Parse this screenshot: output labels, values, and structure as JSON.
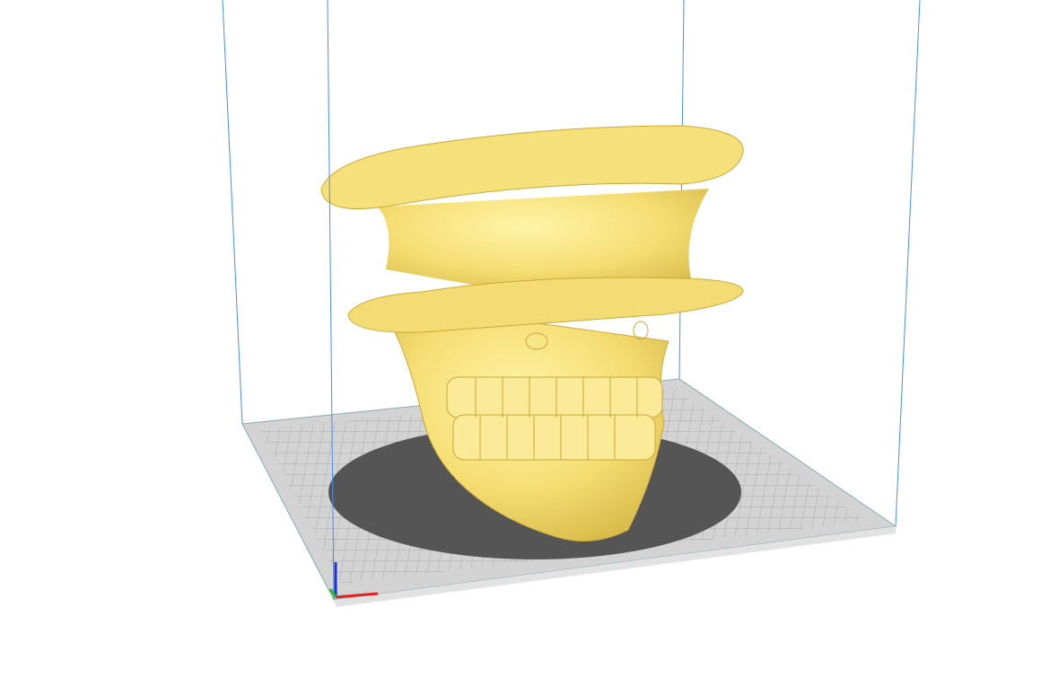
{
  "viewport": {
    "view": "3d-build-volume",
    "colors": {
      "background": "#ffffff",
      "build_volume_lines": "#3b82f6",
      "plate": "#d4d4d4",
      "plate_grid": "#a9a9a9",
      "shadow": "#5a5a5a",
      "model": "#f7e27c",
      "axis_x": "#e02020",
      "axis_y": "#20c020",
      "axis_z": "#2030e0"
    }
  }
}
